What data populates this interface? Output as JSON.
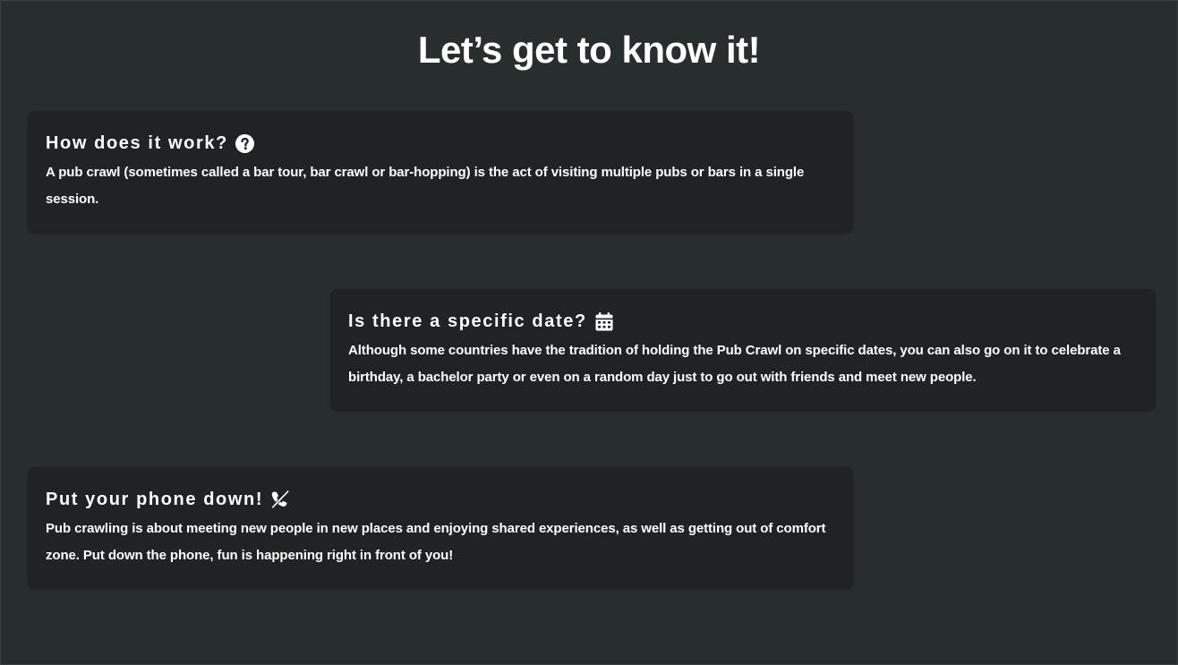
{
  "page": {
    "title": "Let’s get to know it!"
  },
  "cards": [
    {
      "heading": "How does it work?",
      "icon": "question-circle-icon",
      "body": "A pub crawl (sometimes called a bar tour, bar crawl or bar-hopping) is the act of visiting multiple pubs or bars in a single session."
    },
    {
      "heading": "Is there a specific date?",
      "icon": "calendar-icon",
      "body": "Although some countries have the tradition of holding the Pub Crawl on specific dates, you can also go on it to celebrate a birthday, a bachelor party or even on a random day just to go out with friends and meet new people."
    },
    {
      "heading": "Put your phone down!",
      "icon": "phone-slash-icon",
      "body": "Pub crawling is about meeting new people in new places and enjoying shared experiences, as well as getting out of comfort zone. Put down the phone, fun is happening right in front of you!"
    }
  ],
  "colors": {
    "background": "#282d2e",
    "card": "#1f2324",
    "text": "#ffffff"
  }
}
